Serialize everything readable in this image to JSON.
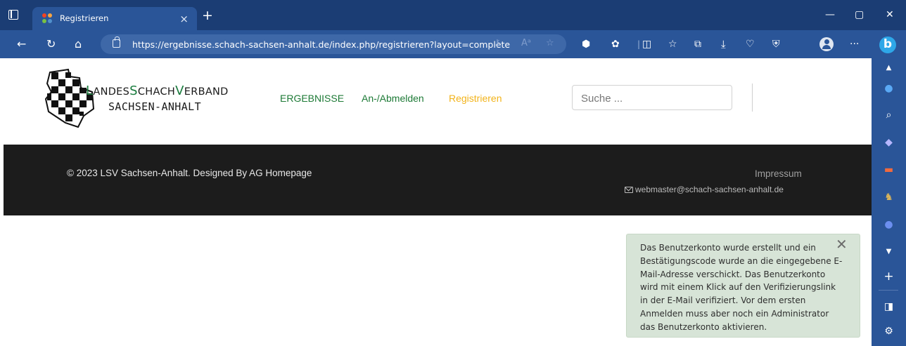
{
  "browser": {
    "tab_title": "Registrieren",
    "tab_close": "×",
    "new_tab": "+",
    "url": "https://ergebnisse.schach-sachsen-anhalt.de/index.php/registrieren?layout=complete",
    "window_controls": {
      "minimize": "—",
      "maximize": "▢",
      "close": "✕"
    },
    "bing_label": "b",
    "accent_color": "#2a5598",
    "titlebar_color": "#1b3d74"
  },
  "site": {
    "brand_line1": {
      "l1": "L",
      "p1": "ANDES",
      "l2": "S",
      "p2": "CHACH",
      "l3": "V",
      "p3": "ERBAND"
    },
    "brand_line2": "SACHSEN-ANHALT",
    "nav": [
      {
        "label": "ERGEBNISSE"
      },
      {
        "label": "An-/Abmelden"
      },
      {
        "label": "Registrieren",
        "active": true
      }
    ],
    "search_placeholder": "Suche ...",
    "nav_color": "#1d7a36",
    "active_color": "#f2b31a"
  },
  "footer": {
    "copyright": "© 2023 LSV Sachsen-Anhalt. Designed By AG Homepage",
    "impressum": "Impressum",
    "email": "webmaster@schach-sachsen-anhalt.de"
  },
  "alert": {
    "message": "Das Benutzerkonto wurde erstellt und ein Bestätigungscode wurde an die eingegebene E-Mail-Adresse verschickt. Das Benutzerkonto wird mit einem Klick auf den Verifizierungslink in der E-Mail verifiziert. Vor dem ersten Anmelden muss aber noch ein Administrator das Benutzerkonto aktivieren.",
    "close": "✕",
    "background": "#d7e4d7"
  }
}
